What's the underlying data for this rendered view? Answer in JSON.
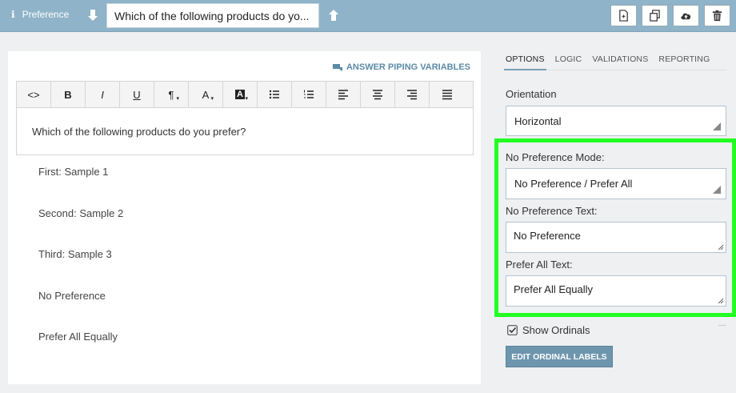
{
  "topbar": {
    "question_type": "Preference",
    "question_title": "Which of the following products do yo...",
    "buttons": [
      "duplicate-page-icon",
      "copy-icon",
      "cloud-upload-icon",
      "trash-icon"
    ]
  },
  "editor": {
    "piping_link": "ANSWER PIPING VARIABLES",
    "toolbar": {
      "code": "<>",
      "bold": "B",
      "italic": "I",
      "underline": "U",
      "paragraph": "¶",
      "font_color": "A",
      "bg_color": "A"
    },
    "question_text": "Which of the following products do you prefer?",
    "options": [
      "First: Sample 1",
      "Second: Sample 2",
      "Third: Sample 3",
      "No Preference",
      "Prefer All Equally"
    ]
  },
  "sidebar": {
    "tabs": [
      "OPTIONS",
      "LOGIC",
      "VALIDATIONS",
      "REPORTING"
    ],
    "active_tab": "OPTIONS",
    "orientation_label": "Orientation",
    "orientation_value": "Horizontal",
    "no_pref_mode_label": "No Preference Mode:",
    "no_pref_mode_value": "No Preference / Prefer All",
    "no_pref_text_label": "No Preference Text:",
    "no_pref_text_value": "No Preference",
    "prefer_all_label": "Prefer All Text:",
    "prefer_all_value": "Prefer All Equally",
    "show_ordinals_label": "Show Ordinals",
    "show_ordinals_checked": true,
    "edit_ordinal_button": "EDIT ORDINAL LABELS"
  },
  "colors": {
    "topbar": "#8fb3c8",
    "accent": "#6e95ae",
    "highlight": "#22ff22"
  }
}
